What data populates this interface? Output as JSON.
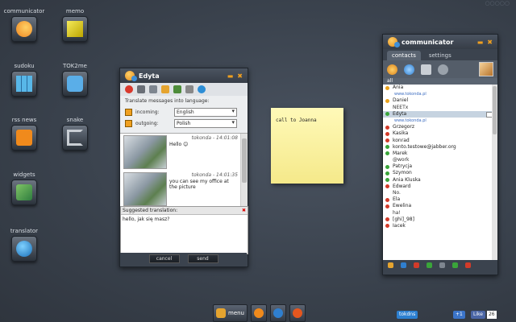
{
  "desktop": {
    "icons": [
      {
        "label": "communicator",
        "icon": "communicator-icon"
      },
      {
        "label": "memo",
        "icon": "memo-icon"
      },
      {
        "label": "sudoku",
        "icon": "sudoku-icon"
      },
      {
        "label": "TOK2me",
        "icon": "tok2me-icon"
      },
      {
        "label": "rss news",
        "icon": "rss-icon"
      },
      {
        "label": "snake",
        "icon": "snake-icon"
      },
      {
        "label": "widgets",
        "icon": "widgets-icon"
      },
      {
        "label": "translator",
        "icon": "globe-icon"
      }
    ]
  },
  "chat_window": {
    "title": "Edyta",
    "translate_label": "Translate messages into language:",
    "incoming_label": "incoming:",
    "incoming_value": "English",
    "outgoing_label": "outgoing:",
    "outgoing_value": "Polish",
    "messages": [
      {
        "author": "tokonda",
        "time": "14:01:08",
        "text": "Hello 😊"
      },
      {
        "author": "tokonda",
        "time": "14:01:35",
        "text": "you can see my office at the picture"
      }
    ],
    "suggested_label": "Suggested translation:",
    "input_text": "hello, jak się masz?",
    "cancel_label": "cancel",
    "send_label": "send"
  },
  "sticky_note": {
    "text": "call to Joanna"
  },
  "communicator": {
    "title": "communicator",
    "tabs": [
      "contacts",
      "settings"
    ],
    "group_label": "all",
    "contacts": [
      {
        "kind": "contact",
        "name": "Ania",
        "status": "away"
      },
      {
        "kind": "link",
        "name": "www.tokonda.pl"
      },
      {
        "kind": "contact",
        "name": "Daniel",
        "status": "away"
      },
      {
        "kind": "note",
        "name": "NEETx"
      },
      {
        "kind": "contact",
        "name": "Edyta",
        "status": "online",
        "selected": true
      },
      {
        "kind": "link",
        "name": "www.tokonda.pl"
      },
      {
        "kind": "contact",
        "name": "Grzegorz",
        "status": "busy"
      },
      {
        "kind": "contact",
        "name": "Kasika",
        "status": "busy"
      },
      {
        "kind": "contact",
        "name": "konrad",
        "status": "busy"
      },
      {
        "kind": "contact",
        "name": "konto.testowe@jabber.org",
        "status": "online"
      },
      {
        "kind": "contact",
        "name": "Marek",
        "status": "online"
      },
      {
        "kind": "note",
        "name": "@work"
      },
      {
        "kind": "contact",
        "name": "Patrycja",
        "status": "online"
      },
      {
        "kind": "contact",
        "name": "Szymon",
        "status": "online"
      },
      {
        "kind": "contact",
        "name": "Ania Kluska",
        "status": "online"
      },
      {
        "kind": "contact",
        "name": "Edward",
        "status": "busy"
      },
      {
        "kind": "note",
        "name": "No."
      },
      {
        "kind": "contact",
        "name": "Ela",
        "status": "busy"
      },
      {
        "kind": "contact",
        "name": "Ewelina",
        "status": "busy"
      },
      {
        "kind": "note",
        "name": "ha!"
      },
      {
        "kind": "contact",
        "name": "[ghi]_98]",
        "status": "busy"
      },
      {
        "kind": "contact",
        "name": "Iacek",
        "status": "busy"
      }
    ]
  },
  "taskbar": {
    "menu_label": "menu"
  },
  "social": {
    "tokdns_label": "tokdns",
    "google_label": "+1",
    "facebook_label": "Like",
    "facebook_count": "26"
  },
  "colors": {
    "accent": "#f0a020",
    "online": "#3aa53a",
    "away": "#e9a21d",
    "busy": "#d23b2a"
  }
}
